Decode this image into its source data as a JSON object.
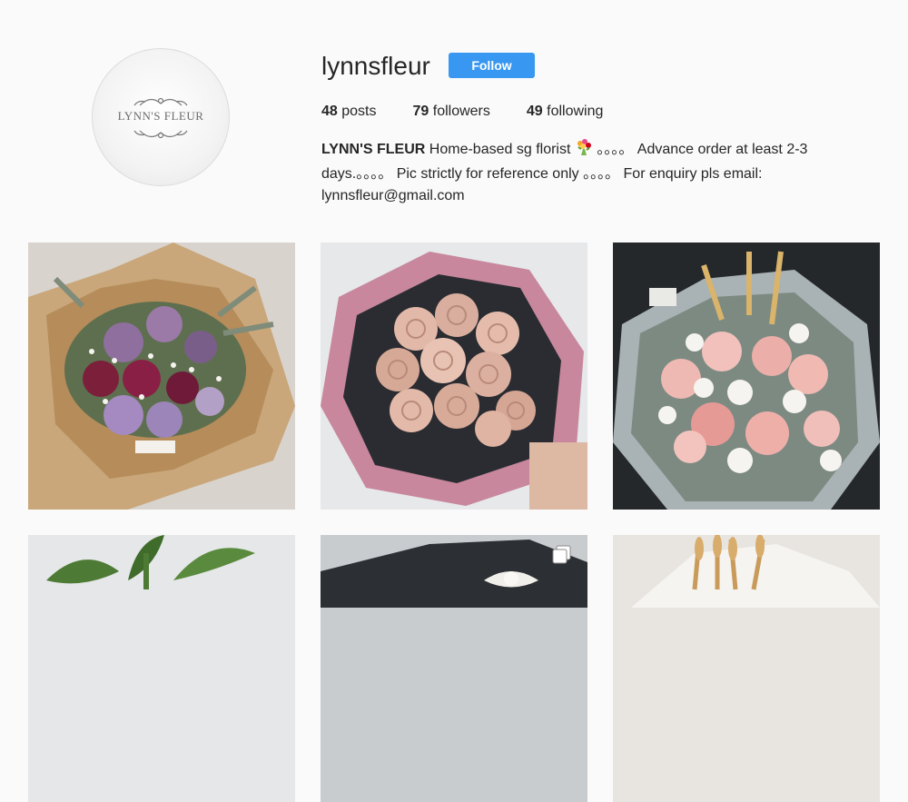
{
  "profile": {
    "username": "lynnsfleur",
    "follow_label": "Follow",
    "avatar_logo_text": "LYNN'S FLEUR",
    "stats": {
      "posts_count": "48",
      "posts_label": "posts",
      "followers_count": "79",
      "followers_label": "followers",
      "following_count": "49",
      "following_label": "following"
    },
    "bio": {
      "name": "LYNN'S FLEUR",
      "line_part1": "Home-based sg florist",
      "emoji_icon": "bouquet-emoji",
      "line_part2": "。。。。 Advance order at least 2-3 days.。。。。 Pic strictly for reference only 。。。。 For enquiry pls email: lynnsfleur@gmail.com"
    }
  },
  "posts": [
    {
      "description": "purple roses bouquet in kraft paper",
      "tag_text": "LYNN'S FLEUR"
    },
    {
      "description": "pink rose bouquet in dark and pink mesh wrap"
    },
    {
      "description": "pink roses with cotton and wheat bouquet"
    },
    {
      "description": "green leafy plant"
    },
    {
      "description": "dark wrapped bouquet with white flowers",
      "icon": "multiple-images-icon"
    },
    {
      "description": "wheat and flowers bouquet"
    }
  ],
  "colors": {
    "follow_button": "#3897f0",
    "background": "#fafafa",
    "text": "#262626"
  }
}
